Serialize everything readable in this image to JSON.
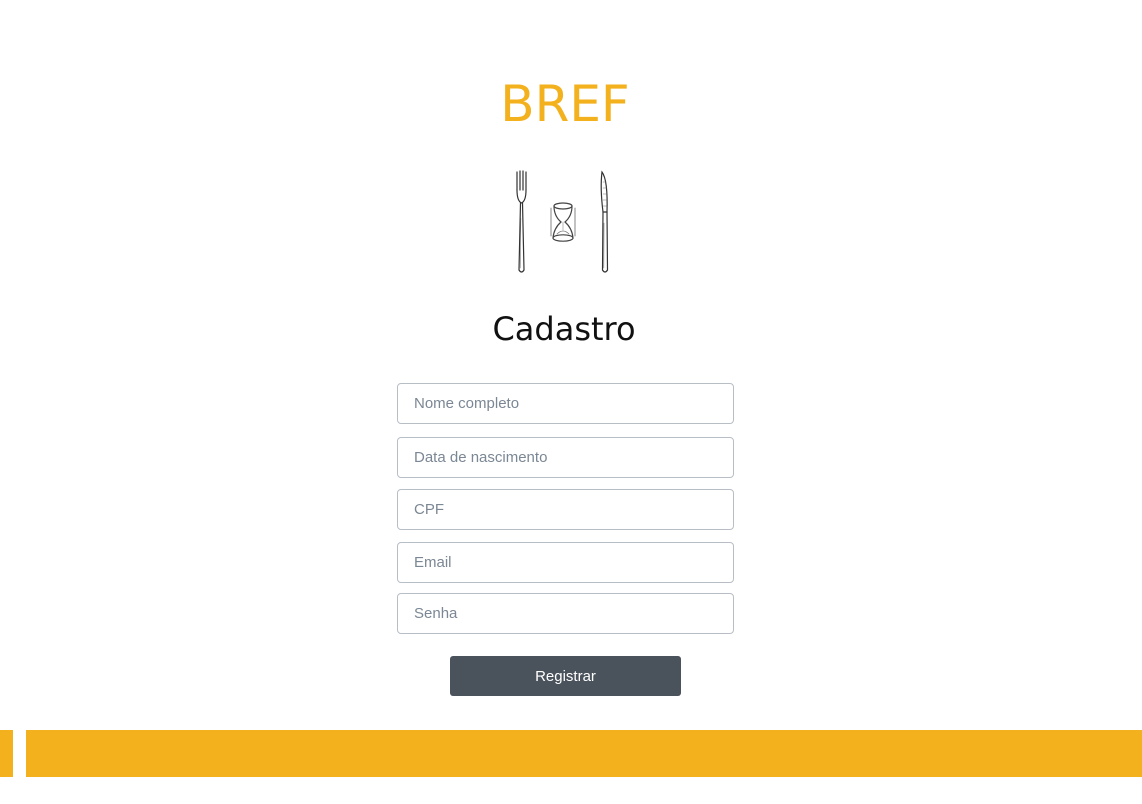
{
  "brand": {
    "title": "BREF",
    "color": "#f3b11e",
    "logo_icon": "fork-hourglass-knife-icon"
  },
  "page": {
    "heading": "Cadastro"
  },
  "form": {
    "fields": [
      {
        "name": "nome",
        "placeholder": "Nome completo",
        "value": ""
      },
      {
        "name": "nascimento",
        "placeholder": "Data de nascimento",
        "value": ""
      },
      {
        "name": "cpf",
        "placeholder": "CPF",
        "value": ""
      },
      {
        "name": "email",
        "placeholder": "Email",
        "value": ""
      },
      {
        "name": "senha",
        "placeholder": "Senha",
        "value": ""
      }
    ],
    "submit_label": "Registrar",
    "submit_color": "#4a525c"
  },
  "footer": {
    "accent_color": "#f3b11e"
  }
}
